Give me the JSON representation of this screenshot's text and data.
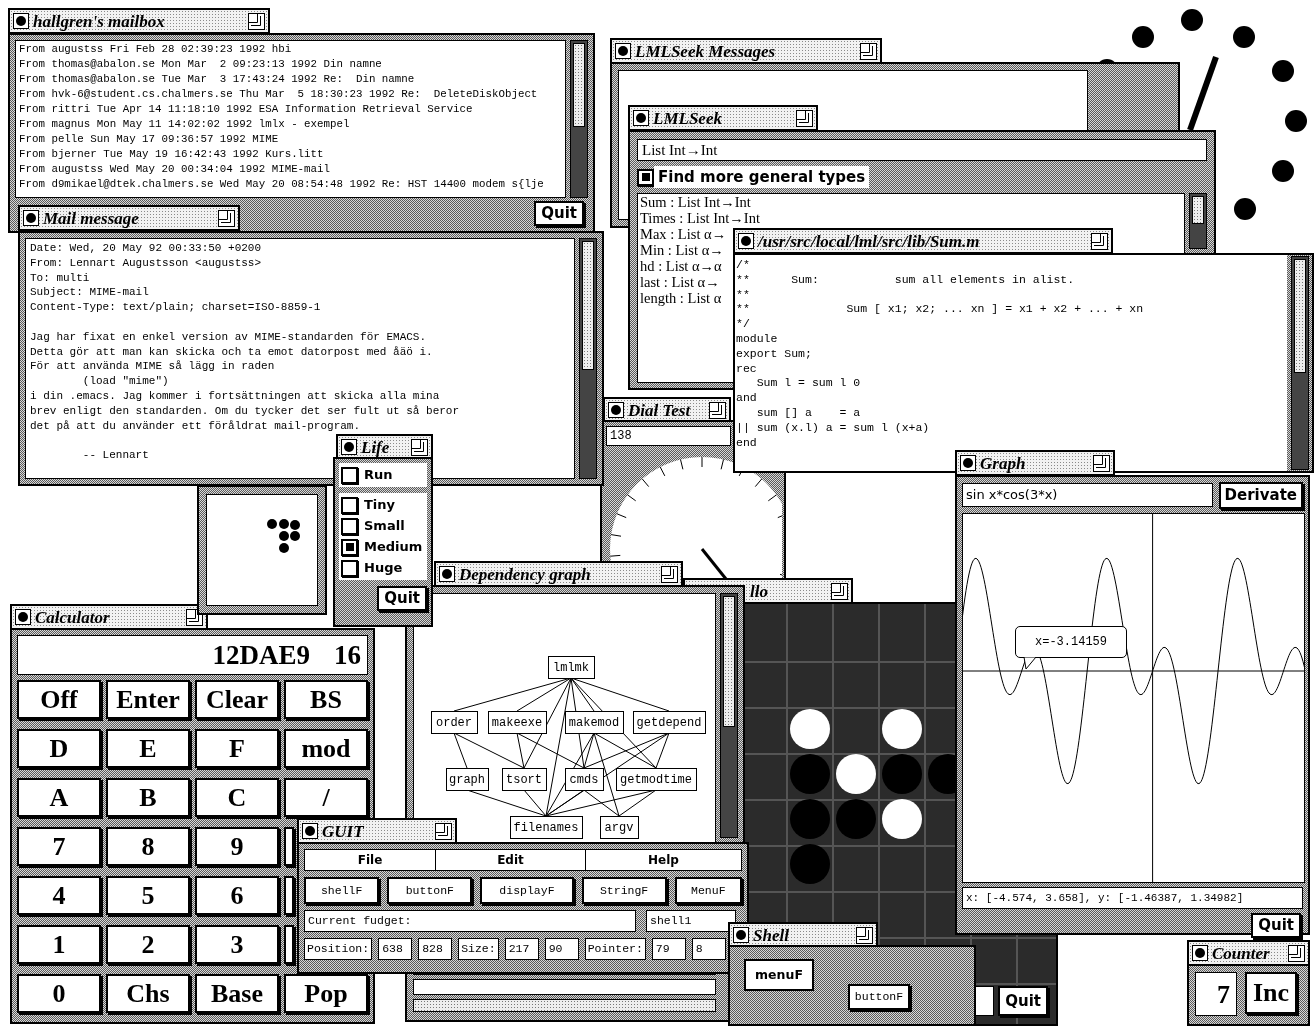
{
  "lmlseek_messages": {
    "title": "LMLSeek Messages"
  },
  "lmlseek": {
    "title": "LMLSeek",
    "query": "List Int→Int",
    "option": {
      "label": "Find more general types",
      "checked": true
    },
    "results": [
      "Sum : List Int→Int",
      "Times : List Int→Int",
      "Max : List α→",
      "Min : List α→",
      "hd : List α→α",
      "last : List α→",
      "length : List α"
    ]
  },
  "dial_test": {
    "title": "Dial Test",
    "value": "138"
  },
  "othello": {
    "title": "llo",
    "quit": "Quit",
    "rows": [
      [
        {
          "kind": "stone",
          "color": "#ffffff"
        },
        {
          "kind": "empty"
        },
        {
          "kind": "stone",
          "color": "#ffffff"
        },
        {
          "kind": "empty"
        }
      ],
      [
        {
          "kind": "stone",
          "color": "#000000"
        },
        {
          "kind": "stone",
          "color": "#ffffff"
        },
        {
          "kind": "stone",
          "color": "#000000"
        },
        {
          "kind": "stone",
          "color": "#000000"
        }
      ],
      [
        {
          "kind": "stone",
          "color": "#000000"
        },
        {
          "kind": "stone",
          "color": "#000000"
        },
        {
          "kind": "stone",
          "color": "#ffffff"
        },
        {
          "kind": "empty"
        }
      ],
      [
        {
          "kind": "stone",
          "color": "#000000"
        },
        {
          "kind": "empty"
        },
        {
          "kind": "empty"
        },
        {
          "kind": "empty"
        }
      ]
    ]
  },
  "sum_file": {
    "title": "/usr/src/local/lml/src/lib/Sum.m",
    "lines": [
      "/*",
      "**      Sum:           sum all elements in alist.",
      "**",
      "**              Sum [ x1; x2; ... xn ] = x1 + x2 + ... + xn",
      "*/",
      "module",
      "export Sum;",
      "rec",
      "   Sum l = sum l 0",
      "and",
      "   sum [] a    = a",
      "|| sum (x.l) a = sum l (x+a)",
      "end"
    ]
  },
  "mailbox": {
    "title": "hallgren's mailbox",
    "quit": "Quit",
    "lines": [
      "From augustss Fri Feb 28 02:39:23 1992 hbi",
      "From thomas@abalon.se Mon Mar  2 09:23:13 1992 Din namne",
      "From thomas@abalon.se Tue Mar  3 17:43:24 1992 Re:  Din namne",
      "From hvk-6@student.cs.chalmers.se Thu Mar  5 18:30:23 1992 Re:  DeleteDiskObject",
      "From rittri Tue Apr 14 11:18:10 1992 ESA Information Retrieval Service",
      "From magnus Mon May 11 14:02:02 1992 lmlx - exempel",
      "From pelle Sun May 17 09:36:57 1992 MIME",
      "From bjerner Tue May 19 16:42:43 1992 Kurs.litt",
      "From augustss Wed May 20 00:34:04 1992 MIME-mail",
      "From d9mikael@dtek.chalmers.se Wed May 20 08:54:48 1992 Re: HST 14400 modem s{lje"
    ]
  },
  "mail_message": {
    "title": "Mail message",
    "headers": [
      "Date: Wed, 20 May 92 00:33:50 +0200",
      "From: Lennart Augustsson <augustss>",
      "To: multi",
      "Subject: MIME-mail",
      "Content-Type: text/plain; charset=ISO-8859-1"
    ],
    "body": [
      "Jag har fixat en enkel version av MIME-standarden för EMACS.",
      "Detta gör att man kan skicka och ta emot datorpost med åäö i.",
      "För att använda MIME så lägg in raden",
      "        (load \"mime\")",
      "i din .emacs. Jag kommer i fortsättningen att skicka alla mina",
      "brev enligt den standarden. Om du tycker det ser fult ut så beror",
      "det på att du använder ett föråldrat mail-program."
    ],
    "signature": "        -- Lennart"
  },
  "calculator": {
    "title": "Calculator",
    "display": "12DAE9",
    "base": "16",
    "keys": [
      [
        "Off",
        "Enter",
        "Clear",
        "BS"
      ],
      [
        "D",
        "E",
        "F",
        "mod"
      ],
      [
        "A",
        "B",
        "C",
        "/"
      ],
      [
        "7",
        "8",
        "9"
      ],
      [
        "4",
        "5",
        "6"
      ],
      [
        "1",
        "2",
        "3"
      ],
      [
        "0",
        "Chs",
        "Base",
        "Pop"
      ]
    ]
  },
  "dependency_graph": {
    "title": "Dependency graph",
    "nodes": [
      "lmlmk",
      "order",
      "makeexe",
      "makemod",
      "getdepend",
      "graph",
      "tsort",
      "cmds",
      "getmodtime",
      "filenames",
      "argv"
    ]
  },
  "life": {
    "title": "Life",
    "run": {
      "label": "Run",
      "checked": false
    },
    "sizes": [
      {
        "label": "Tiny",
        "selected": false
      },
      {
        "label": "Small",
        "selected": false
      },
      {
        "label": "Medium",
        "selected": true
      },
      {
        "label": "Huge",
        "selected": false
      }
    ],
    "quit": "Quit"
  },
  "graph": {
    "title": "Graph",
    "expression": "sin x*cos(3*x)",
    "derivate": "Derivate",
    "tooltip": "x=-3.14159",
    "range": "x: [-4.574, 3.658], y: [-1.46387, 1.34982]",
    "quit": "Quit"
  },
  "guit": {
    "title": "GUIT",
    "menu": [
      "File",
      "Edit",
      "Help"
    ],
    "buttons": [
      "shellF",
      "buttonF",
      "displayF",
      "StringF",
      "MenuF"
    ],
    "current_label": "Current fudget:",
    "current_value": "shell1",
    "fields": [
      {
        "kind": "label",
        "text": "Position:"
      },
      {
        "kind": "value",
        "text": "638"
      },
      {
        "kind": "value",
        "text": "828"
      },
      {
        "kind": "label",
        "text": "Size:"
      },
      {
        "kind": "value",
        "text": "217"
      },
      {
        "kind": "value",
        "text": "90"
      },
      {
        "kind": "label",
        "text": "Pointer:"
      },
      {
        "kind": "value",
        "text": "79"
      },
      {
        "kind": "value",
        "text": "8"
      }
    ]
  },
  "shell": {
    "title": "Shell",
    "menu_button": "menuF",
    "button": "buttonF"
  },
  "counter": {
    "title": "Counter",
    "value": "7",
    "button": "Inc"
  }
}
